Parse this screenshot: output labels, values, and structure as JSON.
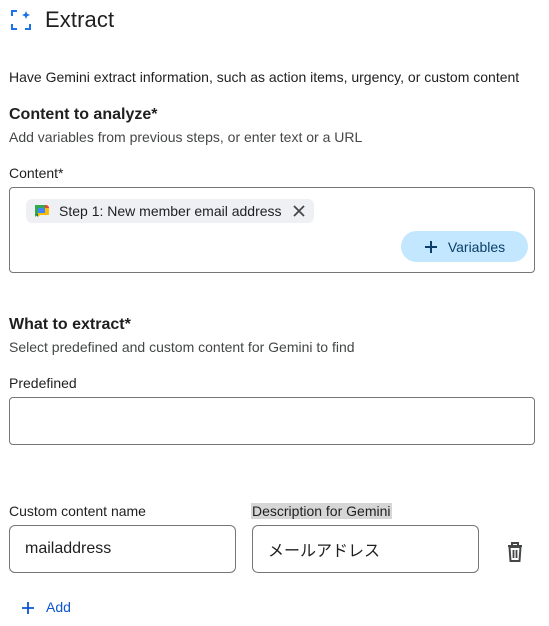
{
  "header": {
    "title": "Extract",
    "icon": "extract-focus-icon"
  },
  "intro": "Have Gemini extract information, such as action items, urgency, or custom content",
  "content_section": {
    "title": "Content to analyze*",
    "subtitle": "Add variables from previous steps, or enter text or a URL",
    "field_label": "Content*",
    "chip": {
      "label": "Step 1: New member email address",
      "icon": "google-chat-icon"
    },
    "variables_button": "Variables"
  },
  "extract_section": {
    "title": "What to extract*",
    "subtitle": "Select predefined and custom content for Gemini to find",
    "predefined_label": "Predefined",
    "predefined_value": ""
  },
  "custom": {
    "name_label": "Custom content name",
    "description_label": "Description for Gemini",
    "name_value": "mailaddress",
    "description_value": "メールアドレス"
  },
  "add_button": "Add",
  "colors": {
    "accent": "#0b57d0",
    "chip_bg": "#eef0f4",
    "button_bg": "#c2e7ff",
    "border": "#747775"
  }
}
